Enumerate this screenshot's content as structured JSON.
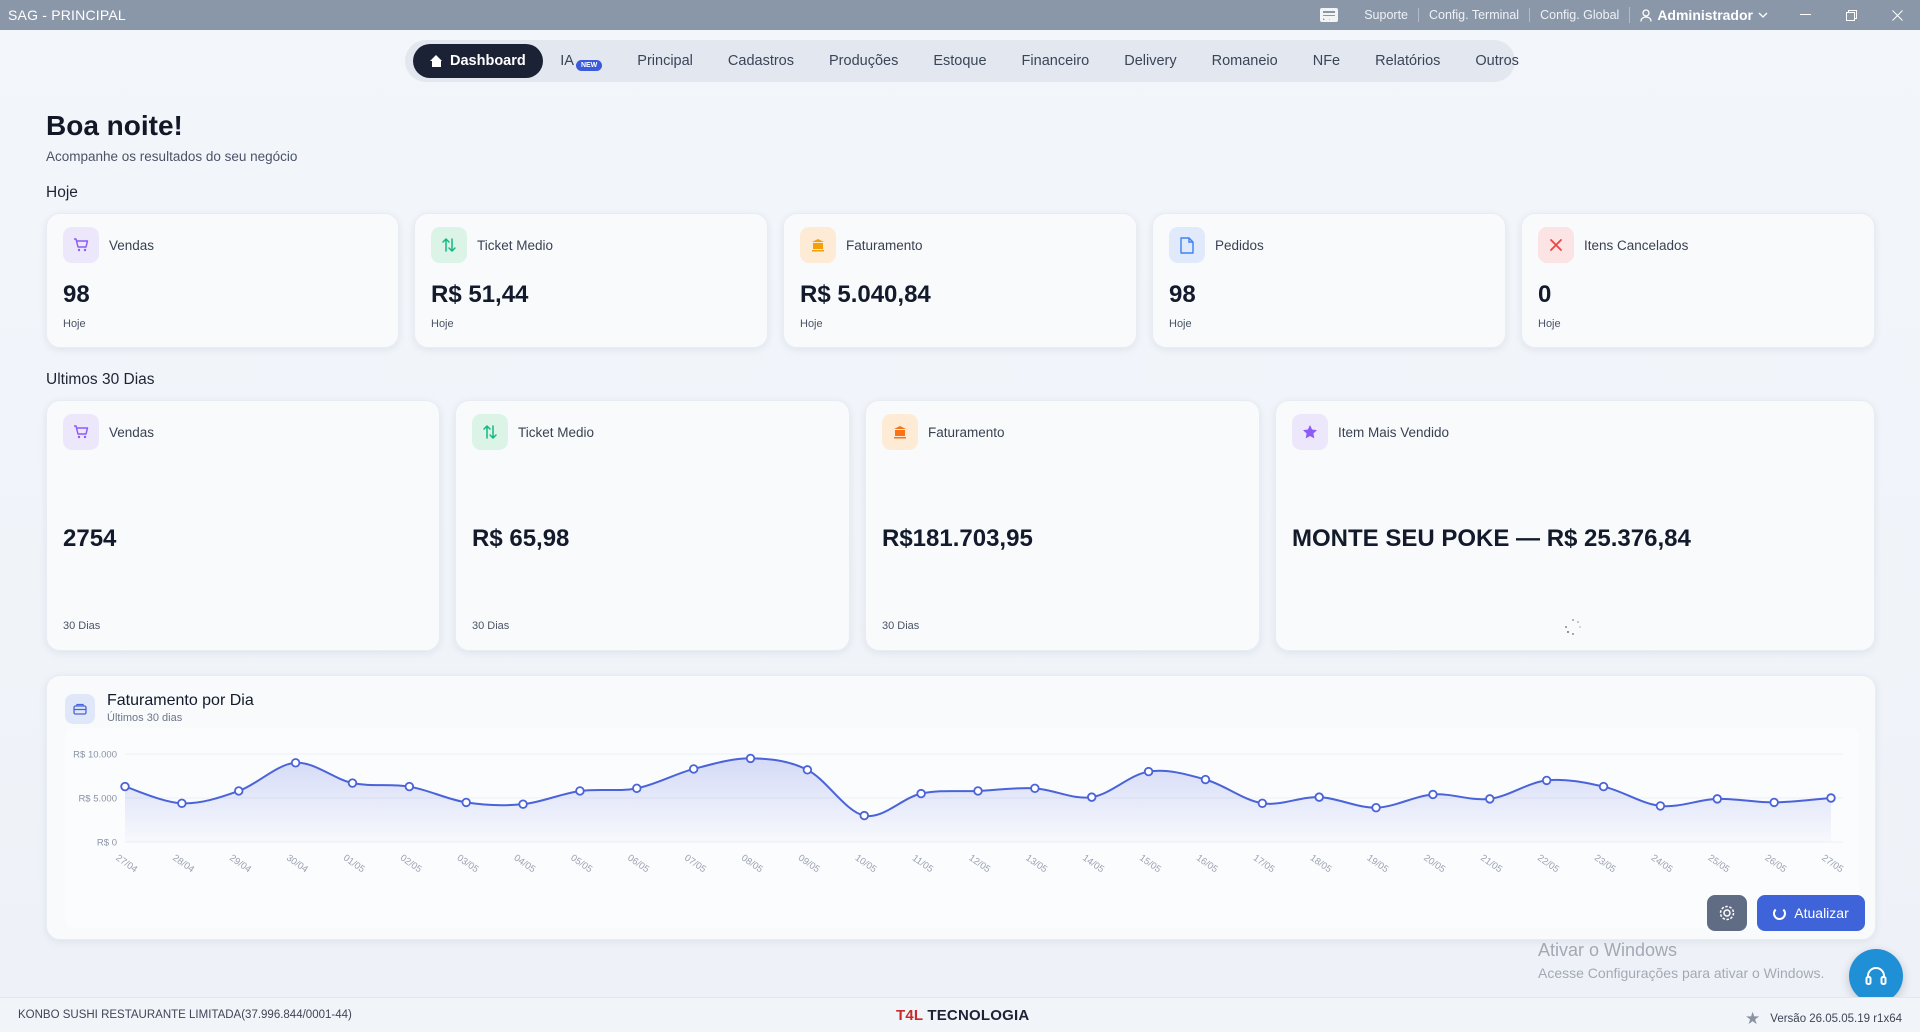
{
  "window": {
    "title": "SAG - PRINCIPAL",
    "links": [
      "Suporte",
      "Config. Terminal",
      "Config. Global"
    ],
    "user": "Administrador"
  },
  "nav": {
    "items": [
      {
        "label": "Dashboard",
        "active": true
      },
      {
        "label": "IA",
        "badge": "NEW"
      },
      {
        "label": "Principal"
      },
      {
        "label": "Cadastros"
      },
      {
        "label": "Produções"
      },
      {
        "label": "Estoque"
      },
      {
        "label": "Financeiro"
      },
      {
        "label": "Delivery"
      },
      {
        "label": "Romaneio"
      },
      {
        "label": "NFe"
      },
      {
        "label": "Relatórios"
      },
      {
        "label": "Outros"
      }
    ]
  },
  "header": {
    "greeting": "Boa noite!",
    "subtitle": "Acompanhe os resultados do seu negócio"
  },
  "today": {
    "section": "Hoje",
    "cards": [
      {
        "label": "Vendas",
        "value": "98",
        "foot": "Hoje",
        "icon": "cart-icon",
        "color": "#8b5cf6"
      },
      {
        "label": "Ticket Medio",
        "value": "R$ 51,44",
        "foot": "Hoje",
        "icon": "arrows-up-down-icon",
        "color": "#10b981"
      },
      {
        "label": "Faturamento",
        "value": "R$ 5.040,84",
        "foot": "Hoje",
        "icon": "bank-icon",
        "color": "#f59e0b"
      },
      {
        "label": "Pedidos",
        "value": "98",
        "foot": "Hoje",
        "icon": "document-icon",
        "color": "#3b82f6"
      },
      {
        "label": "Itens Cancelados",
        "value": "0",
        "foot": "Hoje",
        "icon": "close-icon",
        "color": "#ef4444"
      }
    ]
  },
  "last30": {
    "section": "Ultimos 30 Dias",
    "cards": [
      {
        "label": "Vendas",
        "value": "2754",
        "foot": "30 Dias",
        "icon": "cart-icon",
        "color": "#8b5cf6"
      },
      {
        "label": "Ticket Medio",
        "value": "R$ 65,98",
        "foot": "30 Dias",
        "icon": "arrows-up-down-icon",
        "color": "#10b981"
      },
      {
        "label": "Faturamento",
        "value": "R$181.703,95",
        "foot": "30 Dias",
        "icon": "bank-icon",
        "color": "#f97316"
      },
      {
        "label": "Item Mais Vendido",
        "value": "MONTE SEU POKE — R$ 25.376,84",
        "icon": "star-icon",
        "color": "#8b5cf6"
      }
    ]
  },
  "chart": {
    "title": "Faturamento por Dia",
    "subtitle": "Últimos 30 dias"
  },
  "chart_data": {
    "type": "line",
    "title": "Faturamento por Dia",
    "subtitle": "Últimos 30 dias",
    "x": [
      "27/04",
      "28/04",
      "29/04",
      "30/04",
      "01/05",
      "02/05",
      "03/05",
      "04/05",
      "05/05",
      "06/05",
      "07/05",
      "08/05",
      "09/05",
      "10/05",
      "11/05",
      "12/05",
      "13/05",
      "14/05",
      "15/05",
      "16/05",
      "17/05",
      "18/05",
      "19/05",
      "20/05",
      "21/05",
      "22/05",
      "23/05",
      "24/05",
      "25/05",
      "26/05",
      "27/05"
    ],
    "values": [
      6300,
      4400,
      5800,
      9000,
      6700,
      6300,
      4500,
      4300,
      5800,
      6100,
      8300,
      9500,
      8200,
      3000,
      5500,
      5800,
      6100,
      5100,
      8000,
      7100,
      4400,
      5100,
      3900,
      5400,
      4900,
      7000,
      6300,
      4100,
      4900,
      4500,
      5000
    ],
    "yticks": [
      "R$ 0",
      "R$ 5.000",
      "R$ 10.000"
    ],
    "ylim": [
      0,
      10000
    ],
    "color": "#4a63d8",
    "grid": true
  },
  "actions": {
    "refresh": "Atualizar"
  },
  "watermark": {
    "line1": "Ativar o Windows",
    "line2": "Acesse Configurações para ativar o Windows."
  },
  "status": {
    "company": "KONBO SUSHI RESTAURANTE LIMITADA(37.996.844/0001-44)",
    "brand_prefix": "T4L",
    "brand_suffix": " TECNOLOGIA",
    "version": "Versão 26.05.05.19 r1x64"
  }
}
